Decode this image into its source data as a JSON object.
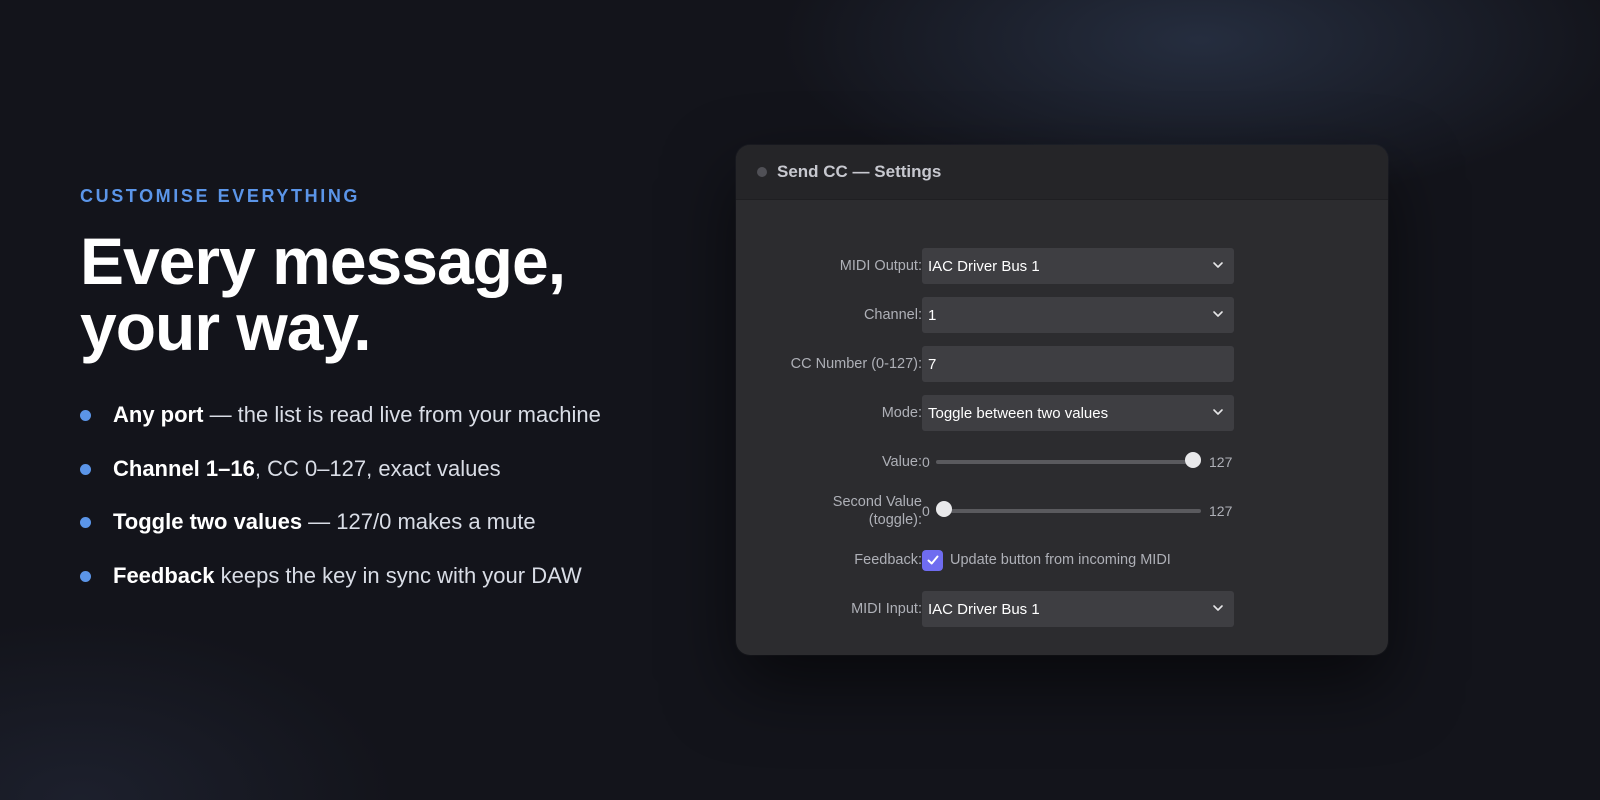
{
  "hero": {
    "eyebrow": "CUSTOMISE EVERYTHING",
    "headline_line1": "Every message,",
    "headline_line2": "your way.",
    "bullets": [
      {
        "bold": "Any port",
        "text": " — the list is read live from your machine"
      },
      {
        "bold": "Channel 1–16",
        "text": ", CC 0–127, exact values"
      },
      {
        "bold": "Toggle two values",
        "text": " — 127/0 makes a mute"
      },
      {
        "bold": "Feedback",
        "text": " keeps the key in sync with your DAW"
      }
    ]
  },
  "window": {
    "title": "Send CC — Settings",
    "fields": {
      "midi_output": {
        "label": "MIDI Output:",
        "value": "IAC Driver Bus 1"
      },
      "channel": {
        "label": "Channel:",
        "value": "1"
      },
      "cc_number": {
        "label": "CC Number (0-127):",
        "value": "7"
      },
      "mode": {
        "label": "Mode:",
        "value": "Toggle between two values"
      },
      "value": {
        "label": "Value:",
        "min": "0",
        "max": "127",
        "current": 127
      },
      "second_value": {
        "label": "Second Value (toggle):",
        "min": "0",
        "max": "127",
        "current": 0
      },
      "feedback": {
        "label": "Feedback:",
        "checkbox_label": "Update button from incoming MIDI",
        "checked": true
      },
      "midi_input": {
        "label": "MIDI Input:",
        "value": "IAC Driver Bus 1"
      }
    }
  },
  "icons": {
    "select_arrow": "chevron-down-icon",
    "checkbox_mark": "checkmark-icon"
  },
  "colors": {
    "accent": "#5b95e8",
    "checkbox": "#6f6cf0"
  }
}
